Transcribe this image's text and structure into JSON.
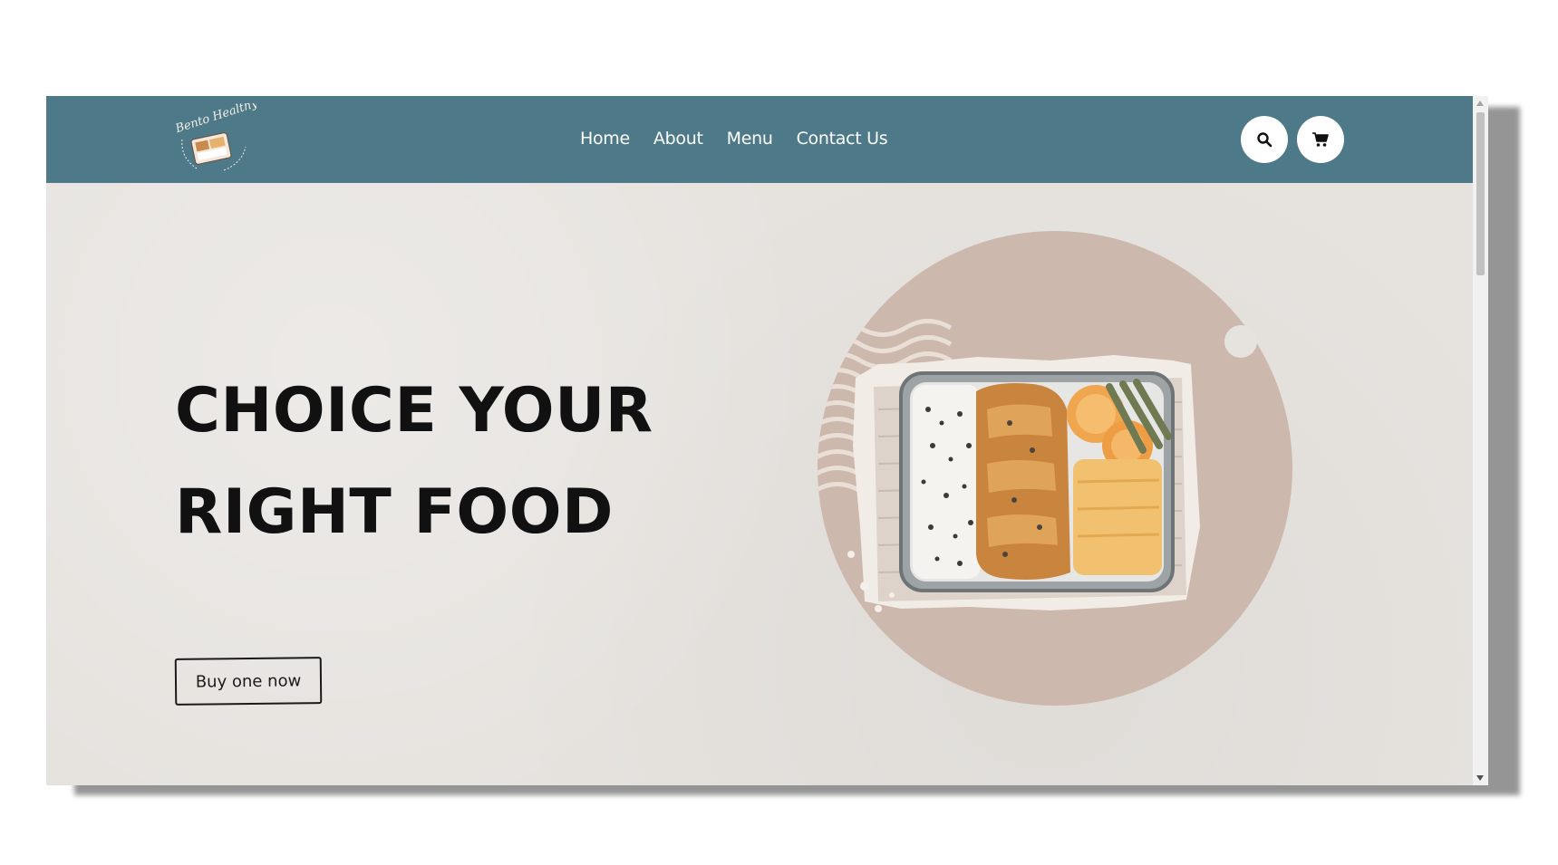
{
  "brand": {
    "logo_icon": "bento-healthy-logo",
    "accent_color": "#4d7989"
  },
  "nav": {
    "items": [
      {
        "label": "Home"
      },
      {
        "label": "About"
      },
      {
        "label": "Menu"
      },
      {
        "label": "Contact Us"
      }
    ],
    "search_icon": "search-icon",
    "cart_icon": "cart-icon"
  },
  "hero": {
    "headline_line1": "CHOICE YOUR",
    "headline_line2": "RIGHT FOOD",
    "cta_label": "Buy one now",
    "image_icon": "bento-box-food-image",
    "circle_color": "#cdb8ad",
    "background_color": "#e6e3df"
  }
}
